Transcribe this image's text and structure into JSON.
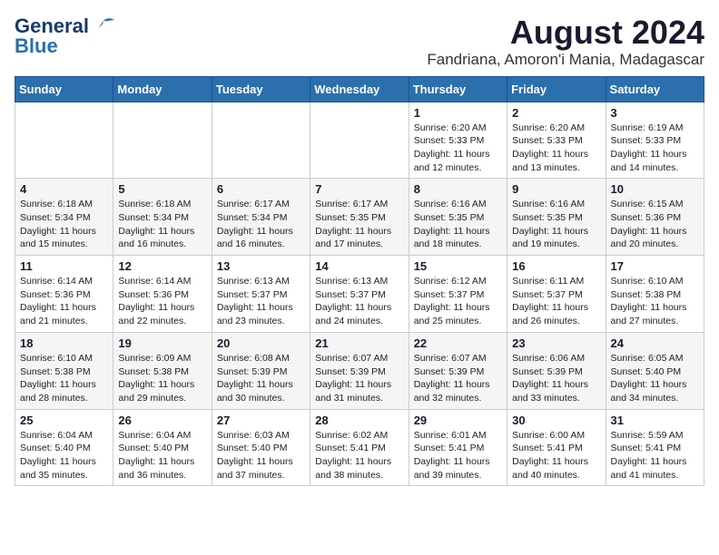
{
  "header": {
    "logo_line1": "General",
    "logo_line2": "Blue",
    "title": "August 2024",
    "subtitle": "Fandriana, Amoron'i Mania, Madagascar"
  },
  "calendar": {
    "days_of_week": [
      "Sunday",
      "Monday",
      "Tuesday",
      "Wednesday",
      "Thursday",
      "Friday",
      "Saturday"
    ],
    "weeks": [
      [
        {
          "day": "",
          "info": ""
        },
        {
          "day": "",
          "info": ""
        },
        {
          "day": "",
          "info": ""
        },
        {
          "day": "",
          "info": ""
        },
        {
          "day": "1",
          "info": "Sunrise: 6:20 AM\nSunset: 5:33 PM\nDaylight: 11 hours\nand 12 minutes."
        },
        {
          "day": "2",
          "info": "Sunrise: 6:20 AM\nSunset: 5:33 PM\nDaylight: 11 hours\nand 13 minutes."
        },
        {
          "day": "3",
          "info": "Sunrise: 6:19 AM\nSunset: 5:33 PM\nDaylight: 11 hours\nand 14 minutes."
        }
      ],
      [
        {
          "day": "4",
          "info": "Sunrise: 6:18 AM\nSunset: 5:34 PM\nDaylight: 11 hours\nand 15 minutes."
        },
        {
          "day": "5",
          "info": "Sunrise: 6:18 AM\nSunset: 5:34 PM\nDaylight: 11 hours\nand 16 minutes."
        },
        {
          "day": "6",
          "info": "Sunrise: 6:17 AM\nSunset: 5:34 PM\nDaylight: 11 hours\nand 16 minutes."
        },
        {
          "day": "7",
          "info": "Sunrise: 6:17 AM\nSunset: 5:35 PM\nDaylight: 11 hours\nand 17 minutes."
        },
        {
          "day": "8",
          "info": "Sunrise: 6:16 AM\nSunset: 5:35 PM\nDaylight: 11 hours\nand 18 minutes."
        },
        {
          "day": "9",
          "info": "Sunrise: 6:16 AM\nSunset: 5:35 PM\nDaylight: 11 hours\nand 19 minutes."
        },
        {
          "day": "10",
          "info": "Sunrise: 6:15 AM\nSunset: 5:36 PM\nDaylight: 11 hours\nand 20 minutes."
        }
      ],
      [
        {
          "day": "11",
          "info": "Sunrise: 6:14 AM\nSunset: 5:36 PM\nDaylight: 11 hours\nand 21 minutes."
        },
        {
          "day": "12",
          "info": "Sunrise: 6:14 AM\nSunset: 5:36 PM\nDaylight: 11 hours\nand 22 minutes."
        },
        {
          "day": "13",
          "info": "Sunrise: 6:13 AM\nSunset: 5:37 PM\nDaylight: 11 hours\nand 23 minutes."
        },
        {
          "day": "14",
          "info": "Sunrise: 6:13 AM\nSunset: 5:37 PM\nDaylight: 11 hours\nand 24 minutes."
        },
        {
          "day": "15",
          "info": "Sunrise: 6:12 AM\nSunset: 5:37 PM\nDaylight: 11 hours\nand 25 minutes."
        },
        {
          "day": "16",
          "info": "Sunrise: 6:11 AM\nSunset: 5:37 PM\nDaylight: 11 hours\nand 26 minutes."
        },
        {
          "day": "17",
          "info": "Sunrise: 6:10 AM\nSunset: 5:38 PM\nDaylight: 11 hours\nand 27 minutes."
        }
      ],
      [
        {
          "day": "18",
          "info": "Sunrise: 6:10 AM\nSunset: 5:38 PM\nDaylight: 11 hours\nand 28 minutes."
        },
        {
          "day": "19",
          "info": "Sunrise: 6:09 AM\nSunset: 5:38 PM\nDaylight: 11 hours\nand 29 minutes."
        },
        {
          "day": "20",
          "info": "Sunrise: 6:08 AM\nSunset: 5:39 PM\nDaylight: 11 hours\nand 30 minutes."
        },
        {
          "day": "21",
          "info": "Sunrise: 6:07 AM\nSunset: 5:39 PM\nDaylight: 11 hours\nand 31 minutes."
        },
        {
          "day": "22",
          "info": "Sunrise: 6:07 AM\nSunset: 5:39 PM\nDaylight: 11 hours\nand 32 minutes."
        },
        {
          "day": "23",
          "info": "Sunrise: 6:06 AM\nSunset: 5:39 PM\nDaylight: 11 hours\nand 33 minutes."
        },
        {
          "day": "24",
          "info": "Sunrise: 6:05 AM\nSunset: 5:40 PM\nDaylight: 11 hours\nand 34 minutes."
        }
      ],
      [
        {
          "day": "25",
          "info": "Sunrise: 6:04 AM\nSunset: 5:40 PM\nDaylight: 11 hours\nand 35 minutes."
        },
        {
          "day": "26",
          "info": "Sunrise: 6:04 AM\nSunset: 5:40 PM\nDaylight: 11 hours\nand 36 minutes."
        },
        {
          "day": "27",
          "info": "Sunrise: 6:03 AM\nSunset: 5:40 PM\nDaylight: 11 hours\nand 37 minutes."
        },
        {
          "day": "28",
          "info": "Sunrise: 6:02 AM\nSunset: 5:41 PM\nDaylight: 11 hours\nand 38 minutes."
        },
        {
          "day": "29",
          "info": "Sunrise: 6:01 AM\nSunset: 5:41 PM\nDaylight: 11 hours\nand 39 minutes."
        },
        {
          "day": "30",
          "info": "Sunrise: 6:00 AM\nSunset: 5:41 PM\nDaylight: 11 hours\nand 40 minutes."
        },
        {
          "day": "31",
          "info": "Sunrise: 5:59 AM\nSunset: 5:41 PM\nDaylight: 11 hours\nand 41 minutes."
        }
      ]
    ]
  }
}
